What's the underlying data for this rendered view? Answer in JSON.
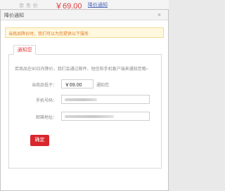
{
  "page": {
    "price_label": "京 东 价",
    "price": "￥69.00",
    "notify_link": "降价通知"
  },
  "dialog": {
    "title": "降价通知",
    "close_icon": "close-icon",
    "notice": "当商品降价时，我们可以为您提供以下服务",
    "tab_label": "通知您",
    "description": "若商品在90日内降价，我们会通过邮件、短信和手机客户端来通知您哦~",
    "price_label": "当商品低于：",
    "price_value": "￥69.00",
    "price_unit": "通知您",
    "phone_label": "手机号码：",
    "email_label": "邮箱地址：",
    "confirm_label": "确定"
  },
  "colors": {
    "accent_red": "#e4393c",
    "notice_text": "#e07a27",
    "notice_bg": "#fff8de",
    "link_blue": "#4a66b8"
  }
}
